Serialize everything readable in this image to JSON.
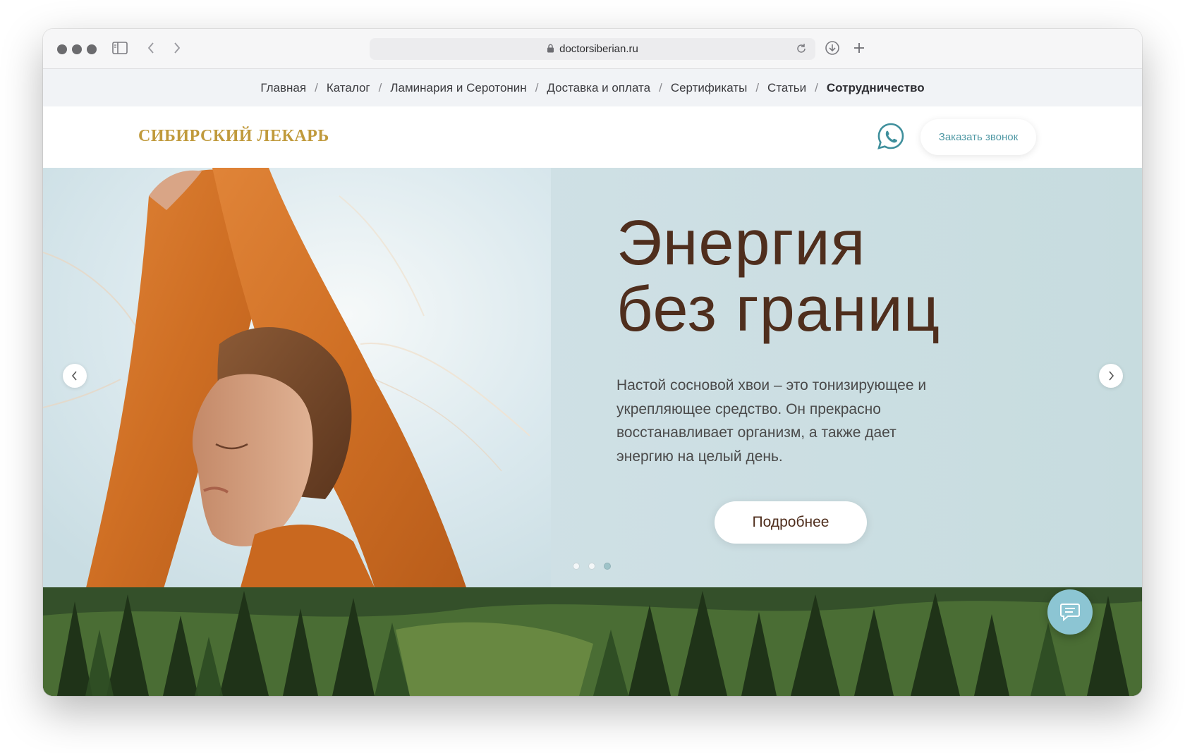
{
  "browser": {
    "url": "doctorsiberian.ru"
  },
  "topnav": {
    "items": [
      {
        "label": "Главная"
      },
      {
        "label": "Каталог"
      },
      {
        "label": "Ламинария и Серотонин"
      },
      {
        "label": "Доставка и оплата"
      },
      {
        "label": "Сертификаты"
      },
      {
        "label": "Статьи"
      },
      {
        "label": "Сотрудничество"
      }
    ],
    "active_index": 6,
    "separator": "/"
  },
  "header": {
    "logo_text": "СИБИРСКИЙ ЛЕКАРЬ",
    "call_button": "Заказать звонок"
  },
  "hero": {
    "title_line1": "Энергия",
    "title_line2": "без границ",
    "text": "Настой сосновой хвои – это тонизирующее и укрепляющее средство. Он прекрасно восстанавливает организм, а также дает энергию на целый день.",
    "button": "Подробнее",
    "slides_total": 3,
    "active_slide": 3
  },
  "colors": {
    "logo": "#c09a3c",
    "hero_title": "#4f2e1d",
    "accent": "#4f98a4",
    "chat_button": "#8cc5d3",
    "whatsapp_icon": "#3f8f9c"
  },
  "icons": {
    "sidebar_toggle": "sidebar-icon",
    "back": "chevron-left-icon",
    "forward": "chevron-right-icon",
    "lock": "lock-icon",
    "reload": "reload-icon",
    "download": "download-icon",
    "new_tab": "plus-icon",
    "whatsapp": "whatsapp-icon",
    "chat": "chat-icon"
  }
}
